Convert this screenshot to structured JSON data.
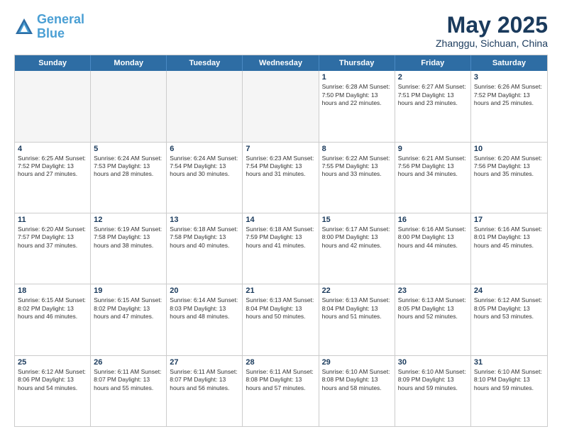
{
  "logo": {
    "line1": "General",
    "line2": "Blue"
  },
  "title": {
    "month": "May 2025",
    "location": "Zhanggu, Sichuan, China"
  },
  "header_days": [
    "Sunday",
    "Monday",
    "Tuesday",
    "Wednesday",
    "Thursday",
    "Friday",
    "Saturday"
  ],
  "weeks": [
    [
      {
        "day": "",
        "info": "",
        "empty": true
      },
      {
        "day": "",
        "info": "",
        "empty": true
      },
      {
        "day": "",
        "info": "",
        "empty": true
      },
      {
        "day": "",
        "info": "",
        "empty": true
      },
      {
        "day": "1",
        "info": "Sunrise: 6:28 AM\nSunset: 7:50 PM\nDaylight: 13 hours\nand 22 minutes."
      },
      {
        "day": "2",
        "info": "Sunrise: 6:27 AM\nSunset: 7:51 PM\nDaylight: 13 hours\nand 23 minutes."
      },
      {
        "day": "3",
        "info": "Sunrise: 6:26 AM\nSunset: 7:52 PM\nDaylight: 13 hours\nand 25 minutes."
      }
    ],
    [
      {
        "day": "4",
        "info": "Sunrise: 6:25 AM\nSunset: 7:52 PM\nDaylight: 13 hours\nand 27 minutes."
      },
      {
        "day": "5",
        "info": "Sunrise: 6:24 AM\nSunset: 7:53 PM\nDaylight: 13 hours\nand 28 minutes."
      },
      {
        "day": "6",
        "info": "Sunrise: 6:24 AM\nSunset: 7:54 PM\nDaylight: 13 hours\nand 30 minutes."
      },
      {
        "day": "7",
        "info": "Sunrise: 6:23 AM\nSunset: 7:54 PM\nDaylight: 13 hours\nand 31 minutes."
      },
      {
        "day": "8",
        "info": "Sunrise: 6:22 AM\nSunset: 7:55 PM\nDaylight: 13 hours\nand 33 minutes."
      },
      {
        "day": "9",
        "info": "Sunrise: 6:21 AM\nSunset: 7:56 PM\nDaylight: 13 hours\nand 34 minutes."
      },
      {
        "day": "10",
        "info": "Sunrise: 6:20 AM\nSunset: 7:56 PM\nDaylight: 13 hours\nand 35 minutes."
      }
    ],
    [
      {
        "day": "11",
        "info": "Sunrise: 6:20 AM\nSunset: 7:57 PM\nDaylight: 13 hours\nand 37 minutes."
      },
      {
        "day": "12",
        "info": "Sunrise: 6:19 AM\nSunset: 7:58 PM\nDaylight: 13 hours\nand 38 minutes."
      },
      {
        "day": "13",
        "info": "Sunrise: 6:18 AM\nSunset: 7:58 PM\nDaylight: 13 hours\nand 40 minutes."
      },
      {
        "day": "14",
        "info": "Sunrise: 6:18 AM\nSunset: 7:59 PM\nDaylight: 13 hours\nand 41 minutes."
      },
      {
        "day": "15",
        "info": "Sunrise: 6:17 AM\nSunset: 8:00 PM\nDaylight: 13 hours\nand 42 minutes."
      },
      {
        "day": "16",
        "info": "Sunrise: 6:16 AM\nSunset: 8:00 PM\nDaylight: 13 hours\nand 44 minutes."
      },
      {
        "day": "17",
        "info": "Sunrise: 6:16 AM\nSunset: 8:01 PM\nDaylight: 13 hours\nand 45 minutes."
      }
    ],
    [
      {
        "day": "18",
        "info": "Sunrise: 6:15 AM\nSunset: 8:02 PM\nDaylight: 13 hours\nand 46 minutes."
      },
      {
        "day": "19",
        "info": "Sunrise: 6:15 AM\nSunset: 8:02 PM\nDaylight: 13 hours\nand 47 minutes."
      },
      {
        "day": "20",
        "info": "Sunrise: 6:14 AM\nSunset: 8:03 PM\nDaylight: 13 hours\nand 48 minutes."
      },
      {
        "day": "21",
        "info": "Sunrise: 6:13 AM\nSunset: 8:04 PM\nDaylight: 13 hours\nand 50 minutes."
      },
      {
        "day": "22",
        "info": "Sunrise: 6:13 AM\nSunset: 8:04 PM\nDaylight: 13 hours\nand 51 minutes."
      },
      {
        "day": "23",
        "info": "Sunrise: 6:13 AM\nSunset: 8:05 PM\nDaylight: 13 hours\nand 52 minutes."
      },
      {
        "day": "24",
        "info": "Sunrise: 6:12 AM\nSunset: 8:05 PM\nDaylight: 13 hours\nand 53 minutes."
      }
    ],
    [
      {
        "day": "25",
        "info": "Sunrise: 6:12 AM\nSunset: 8:06 PM\nDaylight: 13 hours\nand 54 minutes."
      },
      {
        "day": "26",
        "info": "Sunrise: 6:11 AM\nSunset: 8:07 PM\nDaylight: 13 hours\nand 55 minutes."
      },
      {
        "day": "27",
        "info": "Sunrise: 6:11 AM\nSunset: 8:07 PM\nDaylight: 13 hours\nand 56 minutes."
      },
      {
        "day": "28",
        "info": "Sunrise: 6:11 AM\nSunset: 8:08 PM\nDaylight: 13 hours\nand 57 minutes."
      },
      {
        "day": "29",
        "info": "Sunrise: 6:10 AM\nSunset: 8:08 PM\nDaylight: 13 hours\nand 58 minutes."
      },
      {
        "day": "30",
        "info": "Sunrise: 6:10 AM\nSunset: 8:09 PM\nDaylight: 13 hours\nand 59 minutes."
      },
      {
        "day": "31",
        "info": "Sunrise: 6:10 AM\nSunset: 8:10 PM\nDaylight: 13 hours\nand 59 minutes."
      }
    ]
  ]
}
